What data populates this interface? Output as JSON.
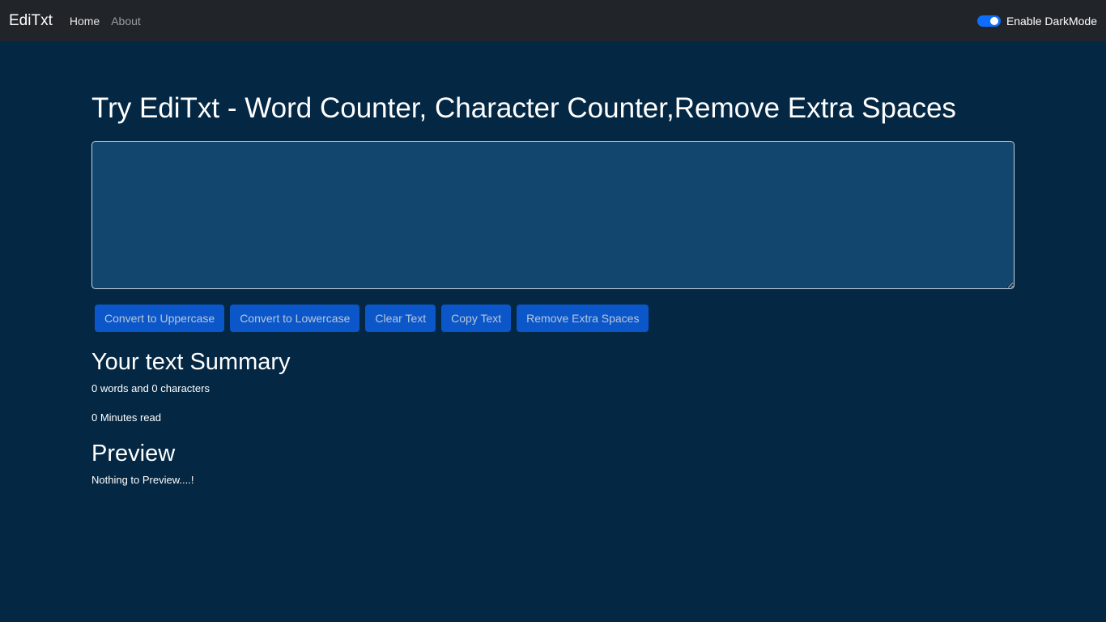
{
  "navbar": {
    "brand": "EdiTxt",
    "links": [
      "Home",
      "About"
    ],
    "darkmode_label": "Enable DarkMode",
    "darkmode_enabled": true
  },
  "main": {
    "title": "Try EdiTxt - Word Counter, Character Counter,Remove Extra Spaces",
    "textarea_value": "",
    "buttons": [
      "Convert to Uppercase",
      "Convert to Lowercase",
      "Clear Text",
      "Copy Text",
      "Remove Extra Spaces"
    ]
  },
  "summary": {
    "title": "Your text Summary",
    "counts": "0 words and 0 characters",
    "read_time": "0 Minutes read"
  },
  "preview": {
    "title": "Preview",
    "text": "Nothing to Preview....!"
  },
  "colors": {
    "background": "#042743",
    "navbar": "#212529",
    "textarea": "#13466e",
    "button": "#0b57c9",
    "switch": "#0d6efd"
  }
}
